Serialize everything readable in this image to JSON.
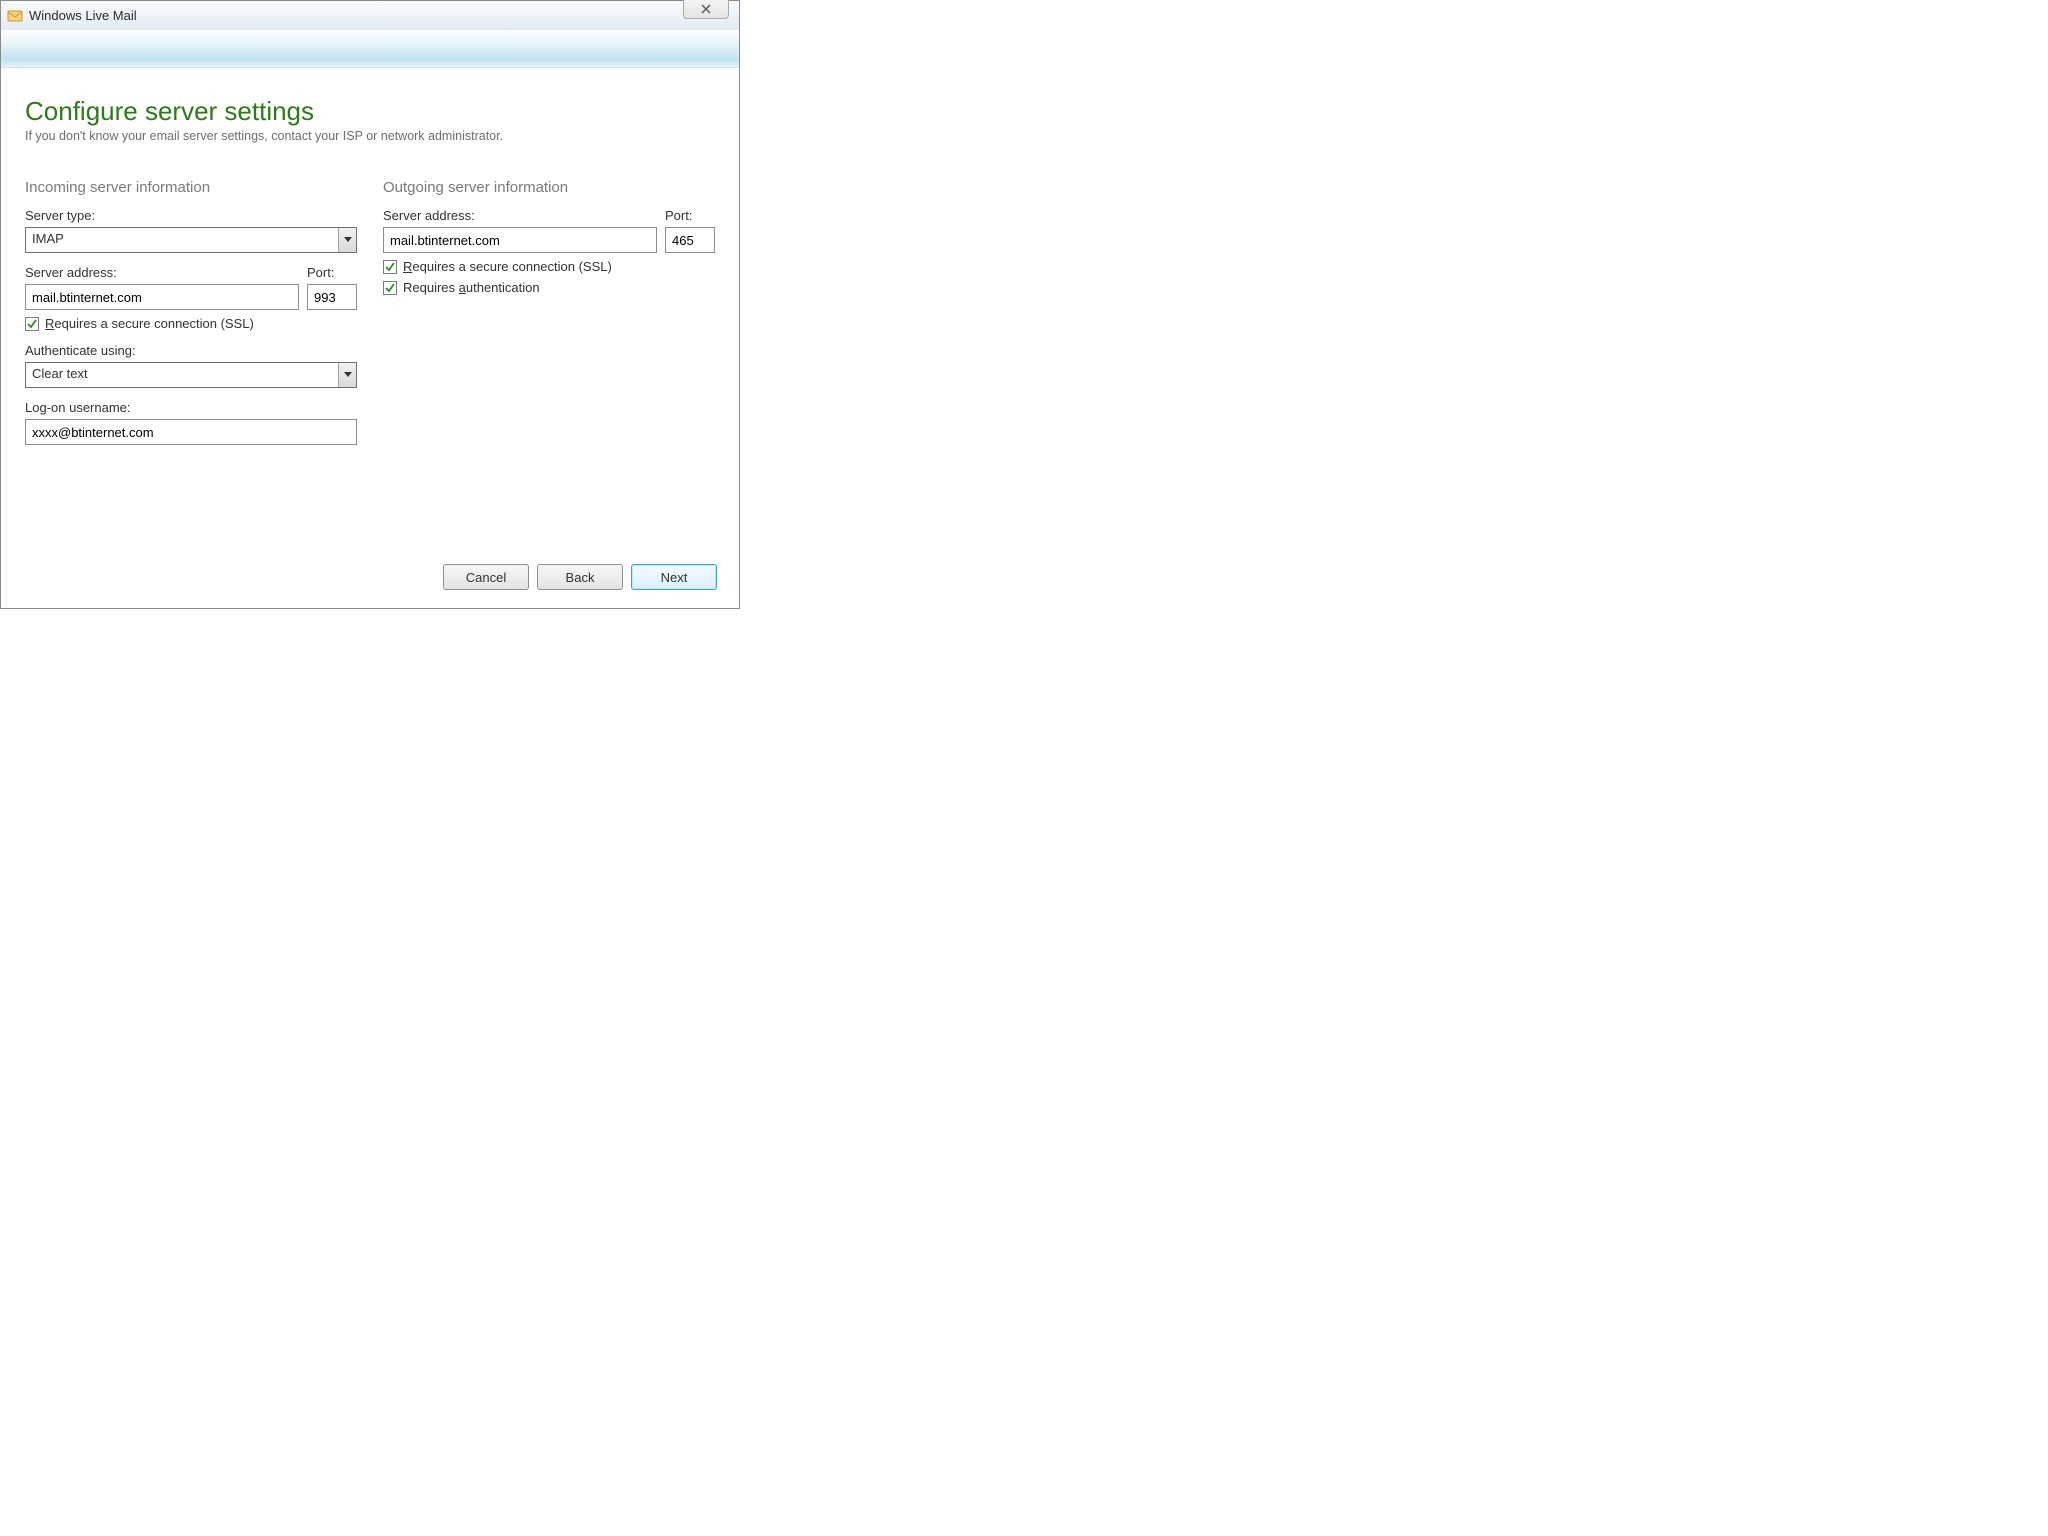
{
  "window": {
    "title": "Windows Live Mail",
    "page_title": "Configure server settings",
    "subtitle": "If you don't know your email server settings, contact your ISP or network administrator."
  },
  "incoming": {
    "section_label": "Incoming server information",
    "server_type_label": "Server type:",
    "server_type_value": "IMAP",
    "server_address_label": "Server address:",
    "server_address_value": "mail.btinternet.com",
    "port_label": "Port:",
    "port_value": "993",
    "ssl_prefix": "R",
    "ssl_rest": "equires a secure connection (SSL)",
    "ssl_checked": true,
    "auth_label": "Authenticate using:",
    "auth_value": "Clear text",
    "logon_label": "Log-on username:",
    "logon_value": "xxxx@btinternet.com"
  },
  "outgoing": {
    "section_label": "Outgoing server information",
    "server_address_label": "Server address:",
    "server_address_value": "mail.btinternet.com",
    "port_label": "Port:",
    "port_value": "465",
    "ssl_prefix": "R",
    "ssl_rest": "equires a secure connection (SSL)",
    "ssl_checked": true,
    "auth_prefix": "Requires ",
    "auth_underline": "a",
    "auth_rest": "uthentication",
    "auth_checked": true
  },
  "footer": {
    "cancel": "Cancel",
    "back": "Back",
    "next": "Next"
  }
}
